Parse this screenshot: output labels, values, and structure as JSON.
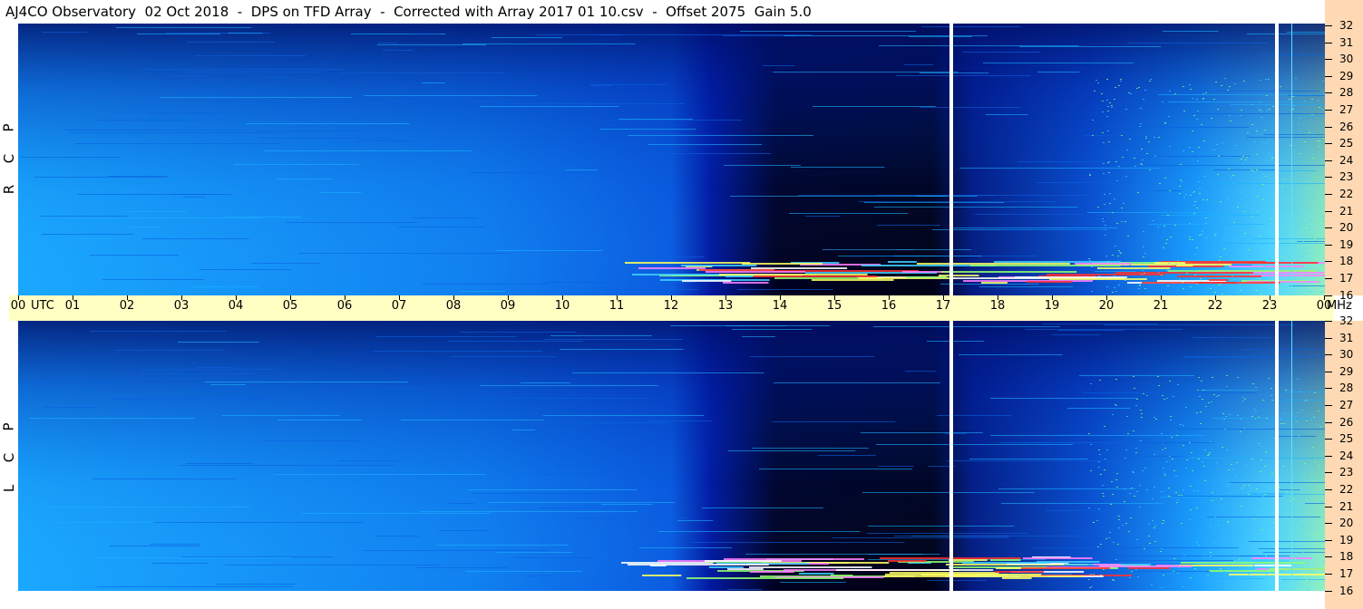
{
  "title": "AJ4CO Observatory  02 Oct 2018  -  DPS on TFD Array  -  Corrected with Array 2017 01 10.csv  -  Offset 2075  Gain 5.0",
  "panels": {
    "rcp": {
      "label_letters": [
        "R",
        "C",
        "P"
      ]
    },
    "lcp": {
      "label_letters": [
        "L",
        "C",
        "P"
      ]
    }
  },
  "time_axis": {
    "utc_label": "UTC",
    "mhz_label": "MHz",
    "hours": [
      "00",
      "01",
      "02",
      "03",
      "04",
      "05",
      "06",
      "07",
      "08",
      "09",
      "10",
      "11",
      "12",
      "13",
      "14",
      "15",
      "16",
      "17",
      "18",
      "19",
      "20",
      "21",
      "22",
      "23",
      "00"
    ]
  },
  "frequency_axis": {
    "labels_mhz": [
      "32",
      "31",
      "30",
      "29",
      "28",
      "27",
      "26",
      "25",
      "24",
      "23",
      "22",
      "21",
      "20",
      "19",
      "18",
      "17",
      "16"
    ]
  },
  "colors": {
    "background_deep": "#000018",
    "mid_blue": "#0033cc",
    "light_blue": "#1aa0ff",
    "cyan": "#40d0ff",
    "green": "#90ff70",
    "yellow": "#ffff60",
    "red": "#ff3030",
    "white": "#ffffff",
    "axis_bg": "#ffffc4",
    "freq_bg": "#ffd9b3"
  }
}
